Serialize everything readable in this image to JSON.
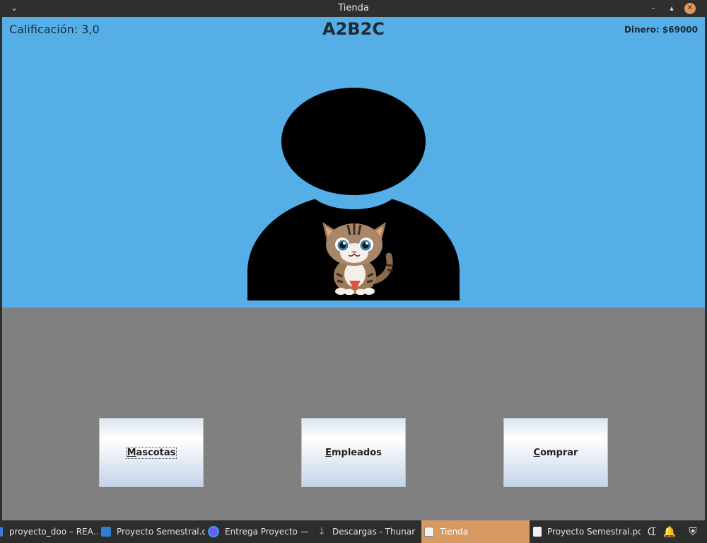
{
  "window": {
    "title": "Tienda",
    "menu_icon": "chevron-down-icon",
    "minimize_icon": "minimize-icon",
    "maximize_icon": "maximize-icon",
    "close_icon": "close-icon",
    "close_color": "#e5945a"
  },
  "header": {
    "rating": "Calificación: 3,0",
    "store_name": "A2B2C",
    "money": "Dinero: $69000"
  },
  "scene": {
    "sky_color": "#55aee6",
    "floor_color": "#808080",
    "avatar_icon": "person-silhouette-icon",
    "shirt_image": "cat-icon"
  },
  "buttons": [
    {
      "mnemonic": "M",
      "rest": "ascotas",
      "label": "Mascotas",
      "focused": true
    },
    {
      "mnemonic": "E",
      "rest": "mpleados",
      "label": "Empleados",
      "focused": false
    },
    {
      "mnemonic": "C",
      "rest": "omprar",
      "label": "Comprar",
      "focused": false
    }
  ],
  "taskbar": {
    "tasks": [
      {
        "label": "proyecto_doo – REA…",
        "icon": "idea-icon",
        "active": false
      },
      {
        "label": "Proyecto Semestral.o…",
        "icon": "document-icon",
        "active": false
      },
      {
        "label": "Entrega Proyecto — …",
        "icon": "browser-icon",
        "active": false
      },
      {
        "label": "Descargas - Thunar",
        "icon": "download-icon",
        "active": false
      },
      {
        "label": "Tienda",
        "icon": "java-icon",
        "active": true
      },
      {
        "label": "Proyecto Semestral.pdf",
        "icon": "pdf-icon",
        "active": false
      }
    ],
    "tray": [
      "bluetooth-icon",
      "bell-icon",
      "shield-icon"
    ],
    "active_color": "#d69a62"
  }
}
